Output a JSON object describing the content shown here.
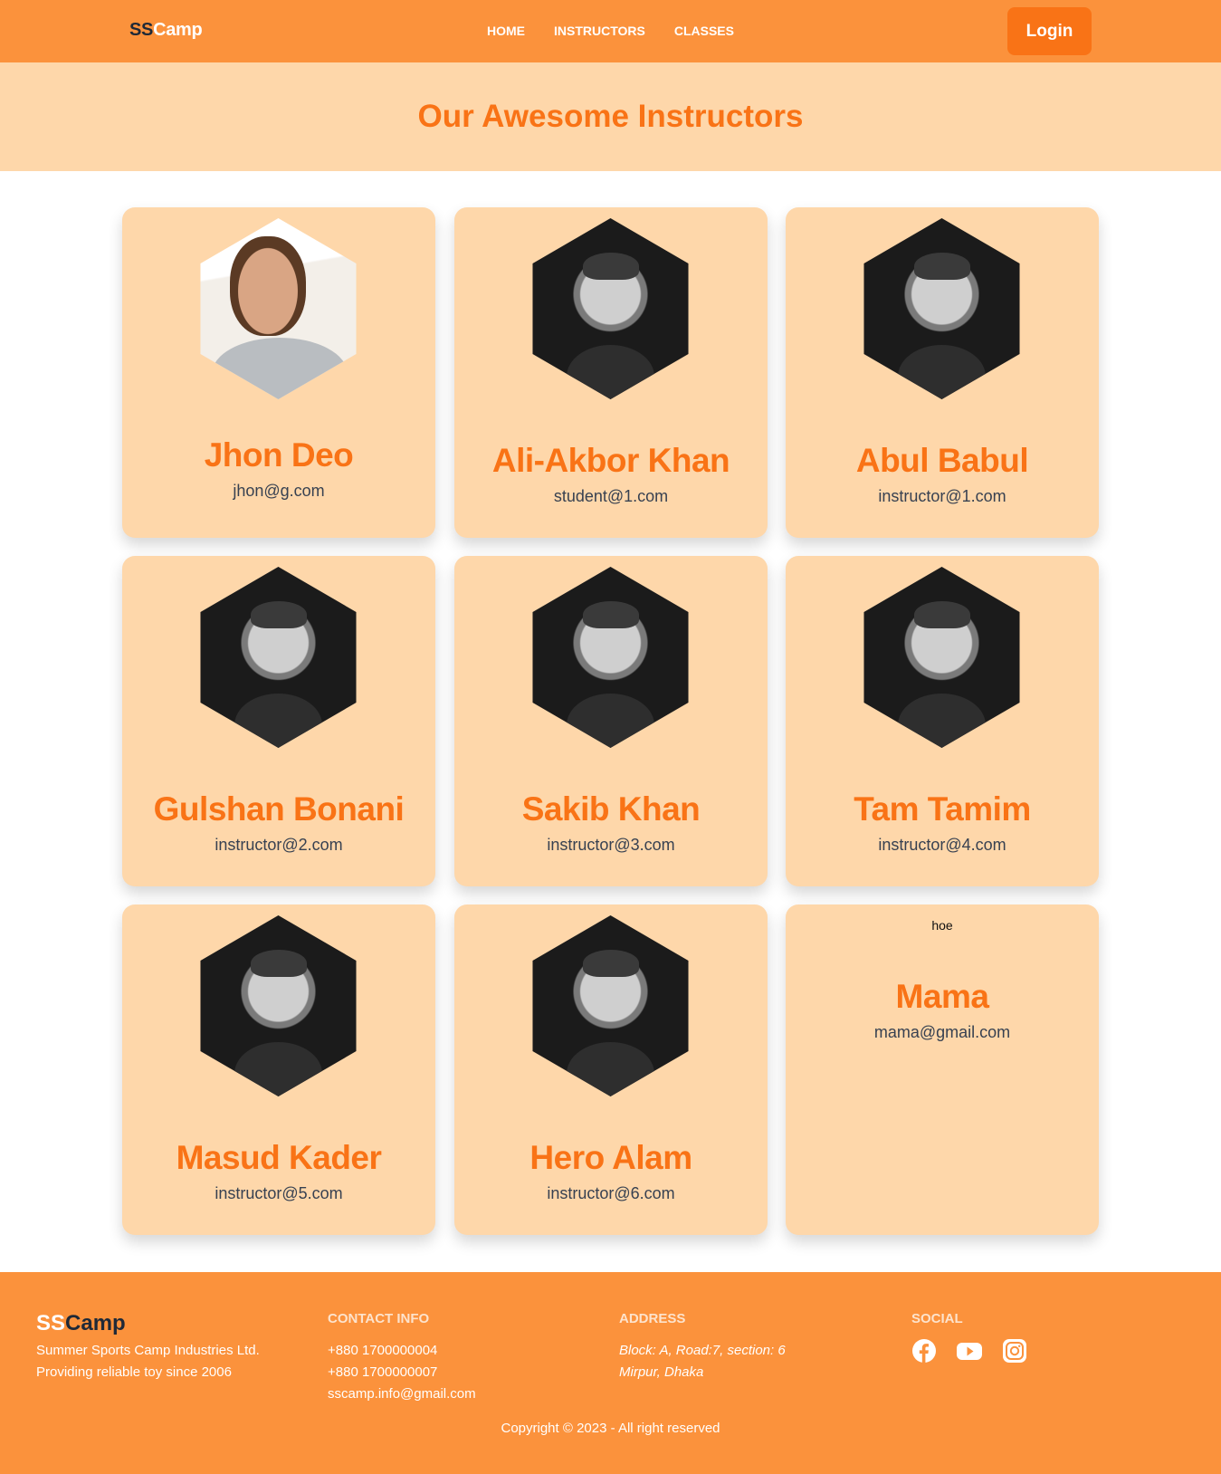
{
  "header": {
    "logo_ss": "SS",
    "logo_camp": "Camp",
    "nav": [
      {
        "label": "HOME"
      },
      {
        "label": "INSTRUCTORS"
      },
      {
        "label": "CLASSES"
      }
    ],
    "login_label": "Login"
  },
  "banner": {
    "title": "Our Awesome Instructors"
  },
  "instructors": [
    {
      "name": "Jhon Deo",
      "email": "jhon@g.com",
      "photo": "color-portrait"
    },
    {
      "name": "Ali-Akbor Khan",
      "email": "student@1.com",
      "photo": "bw-portrait"
    },
    {
      "name": "Abul Babul",
      "email": "instructor@1.com",
      "photo": "bw-portrait"
    },
    {
      "name": "Gulshan Bonani",
      "email": "instructor@2.com",
      "photo": "bw-portrait"
    },
    {
      "name": "Sakib Khan",
      "email": "instructor@3.com",
      "photo": "bw-portrait"
    },
    {
      "name": "Tam Tamim",
      "email": "instructor@4.com",
      "photo": "bw-portrait"
    },
    {
      "name": "Masud Kader",
      "email": "instructor@5.com",
      "photo": "bw-portrait"
    },
    {
      "name": "Hero Alam",
      "email": "instructor@6.com",
      "photo": "bw-portrait"
    },
    {
      "name": "Mama",
      "email": "mama@gmail.com",
      "photo": "broken",
      "broken_alt": "hoe"
    }
  ],
  "footer": {
    "logo_ss": "SS",
    "logo_camp": "Camp",
    "company_lines": [
      "Summer Sports Camp Industries Ltd.",
      "Providing reliable toy since 2006"
    ],
    "contact_heading": "CONTACT INFO",
    "contact_lines": [
      "+880 1700000004",
      "+880 1700000007",
      "sscamp.info@gmail.com"
    ],
    "address_heading": "ADDRESS",
    "address_lines": [
      "Block: A, Road:7, section: 6",
      "Mirpur, Dhaka"
    ],
    "social_heading": "SOCIAL",
    "social_icons": [
      "facebook-icon",
      "youtube-icon",
      "instagram-icon"
    ],
    "copyright": "Copyright © 2023 - All right reserved"
  },
  "colors": {
    "brand_orange": "#fb923c",
    "accent_orange": "#f97316",
    "card_peach": "#fed7aa"
  }
}
